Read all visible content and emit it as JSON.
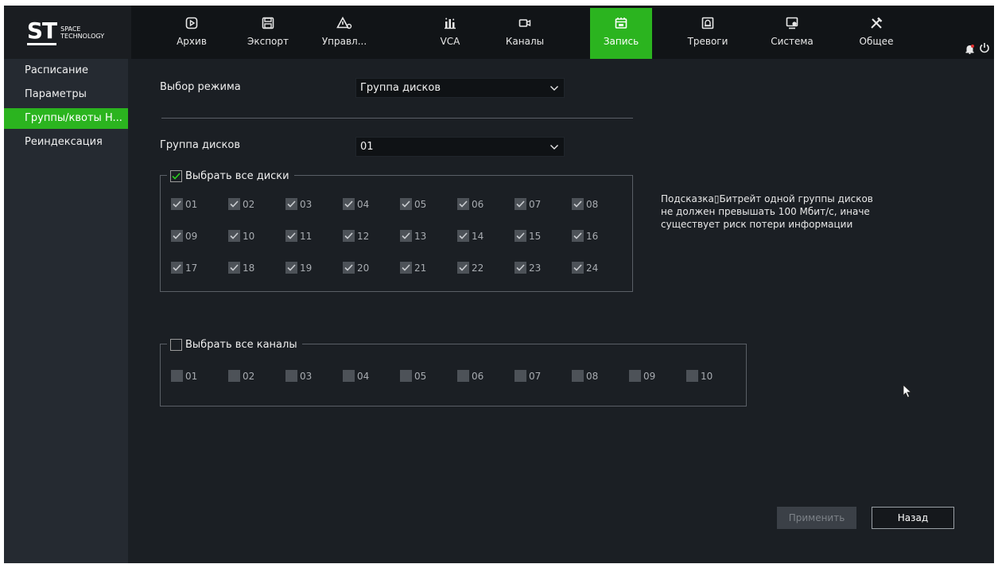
{
  "logo": {
    "main": "ST",
    "sub": "SPACE TECHNOLOGY"
  },
  "nav": [
    {
      "label": "Архив",
      "icon": "archive-play-icon"
    },
    {
      "label": "Экспорт",
      "icon": "save-icon"
    },
    {
      "label": "Управл...",
      "icon": "warning-manage-icon"
    },
    {
      "label": "VCA",
      "icon": "vca-icon"
    },
    {
      "label": "Каналы",
      "icon": "camera-icon"
    },
    {
      "label": "Запись",
      "icon": "record-icon",
      "active": true
    },
    {
      "label": "Тревоги",
      "icon": "alarm-icon"
    },
    {
      "label": "Система",
      "icon": "system-icon"
    },
    {
      "label": "Общее",
      "icon": "tools-icon"
    }
  ],
  "sidebar": {
    "items": [
      {
        "label": "Расписание"
      },
      {
        "label": "Параметры"
      },
      {
        "label": "Группы/квоты H..."
      },
      {
        "label": "Реиндексация"
      }
    ],
    "active_index": 2
  },
  "form": {
    "mode_label": "Выбор режима",
    "mode_value": "Группа дисков",
    "group_label": "Группа дисков",
    "group_value": "01"
  },
  "disks": {
    "select_all_label": "Выбрать все диски",
    "items": [
      "01",
      "02",
      "03",
      "04",
      "05",
      "06",
      "07",
      "08",
      "09",
      "10",
      "11",
      "12",
      "13",
      "14",
      "15",
      "16",
      "17",
      "18",
      "19",
      "20",
      "21",
      "22",
      "23",
      "24"
    ]
  },
  "channels": {
    "select_all_label": "Выбрать все каналы",
    "items": [
      "01",
      "02",
      "03",
      "04",
      "05",
      "06",
      "07",
      "08",
      "09",
      "10"
    ]
  },
  "hint": "Подсказка▯Битрейт одной группы дисков не должен превышать 100 Мбит/с, иначе существует риск потери информации",
  "buttons": {
    "apply": "Применить",
    "back": "Назад"
  },
  "colors": {
    "accent": "#2bb41f",
    "background": "#1b1f24",
    "sidebar": "#252a31",
    "topbar": "#111417"
  }
}
